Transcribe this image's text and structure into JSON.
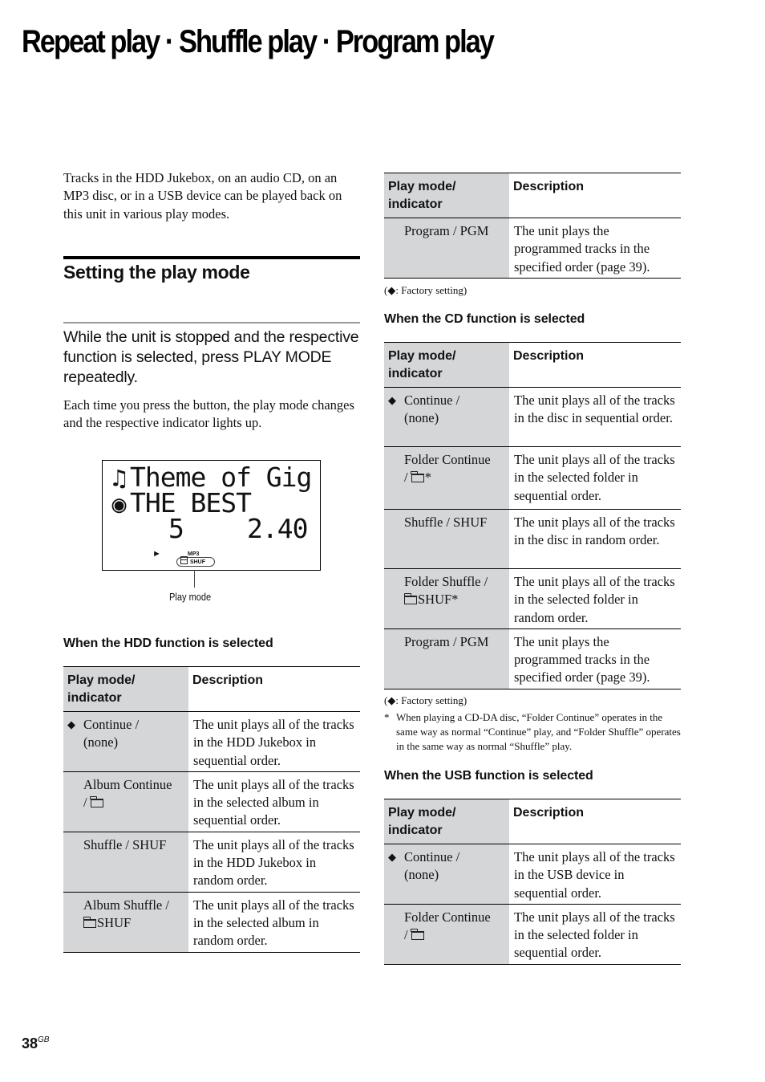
{
  "page": {
    "title": "Repeat play · Shuffle play · Program play",
    "intro": "Tracks in the HDD Jukebox, on an audio CD, on an MP3 disc, or in a USB device can be played back on this unit in various play modes.",
    "section_heading": "Setting the play mode",
    "step_instruction": "While the unit is stopped and the respective function is selected, press PLAY MODE repeatedly.",
    "step_note": "Each time you press the button, the play mode changes and the respective indicator lights up.",
    "page_number": "38",
    "page_suffix": "GB"
  },
  "display": {
    "line1_icon": "music-note-icon",
    "line1": "Theme of Gig",
    "line2_icon": "disc-icon",
    "line2": "THE BEST",
    "track": "5",
    "time": "2.40",
    "play_symbol": "►",
    "format_label": "MP3",
    "mode_label": "SHUF",
    "caption": "Play mode"
  },
  "columns": {
    "mode_line1": "Play mode/",
    "mode_line2": "indicator",
    "description": "Description"
  },
  "factory_note": ": Factory setting",
  "factory_mark": "◆",
  "hdd": {
    "title": "When the HDD function is selected",
    "rows": [
      {
        "mark": "◆",
        "mode": "Continue / (none)",
        "folder": false,
        "desc": "The unit plays all of the tracks in the HDD Jukebox in sequential order."
      },
      {
        "mark": "",
        "mode_a": "Album Continue",
        "mode_b": "/",
        "folder": true,
        "desc": "The unit plays all of the tracks in the selected album in sequential order."
      },
      {
        "mark": "",
        "mode": "Shuffle / SHUF",
        "folder": false,
        "desc": "The unit plays all of the tracks in the HDD Jukebox in random order."
      },
      {
        "mark": "",
        "mode_a": "Album Shuffle /",
        "mode_b": "SHUF",
        "folder": true,
        "desc": "The unit plays all of the tracks in the selected album in random order."
      }
    ]
  },
  "hdd_continued": {
    "rows": [
      {
        "mark": "",
        "mode": "Program / PGM",
        "desc": "The unit plays the programmed tracks in the specified order (page 39)."
      }
    ]
  },
  "cd": {
    "title": "When the CD function is selected",
    "rows": [
      {
        "mark": "◆",
        "mode": "Continue / (none)",
        "desc": "The unit plays all of the tracks in the disc in sequential order."
      },
      {
        "mark": "",
        "mode_a": "Folder Continue",
        "mode_b": "/",
        "mode_c": "*",
        "desc": "The unit plays all of the tracks in the selected folder in sequential order."
      },
      {
        "mark": "",
        "mode": "Shuffle / SHUF",
        "desc": "The unit plays all of the tracks in the disc in random order."
      },
      {
        "mark": "",
        "mode_a": "Folder Shuffle /",
        "mode_b": "SHUF*",
        "desc": "The unit plays all of the tracks in the selected folder in random order."
      },
      {
        "mark": "",
        "mode": "Program / PGM",
        "desc": "The unit plays the programmed tracks in the specified order (page 39)."
      }
    ],
    "footnote_star": "*",
    "footnote": "When playing a CD-DA disc, “Folder Continue” operates in the same way as normal “Continue” play, and “Folder Shuffle” operates in the same way as normal “Shuffle” play."
  },
  "usb": {
    "title": "When the USB function is selected",
    "rows": [
      {
        "mark": "◆",
        "mode": "Continue / (none)",
        "desc": "The unit plays all of the tracks in the USB device in sequential order."
      },
      {
        "mark": "",
        "mode_a": "Folder Continue",
        "mode_b": "/",
        "desc": "The unit plays all of the tracks in the selected folder in sequential order."
      }
    ]
  }
}
